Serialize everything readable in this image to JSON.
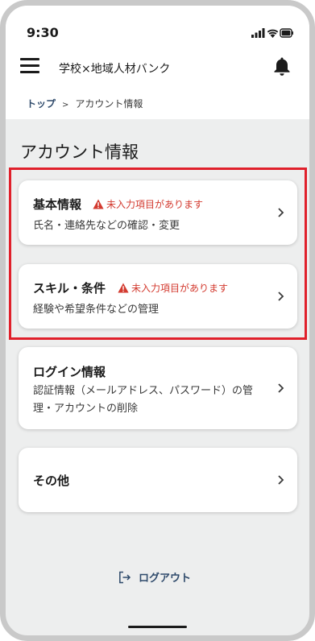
{
  "status_bar": {
    "time": "9:30"
  },
  "header": {
    "title": "学校×地域人材バンク"
  },
  "breadcrumb": {
    "home": "トップ",
    "current": "アカウント情報"
  },
  "page": {
    "title": "アカウント情報"
  },
  "cards": [
    {
      "title": "基本情報",
      "warning": "未入力項目があります",
      "desc": "氏名・連絡先などの確認・変更"
    },
    {
      "title": "スキル・条件",
      "warning": "未入力項目があります",
      "desc": "経験や希望条件などの管理"
    },
    {
      "title": "ログイン情報",
      "desc": "認証情報（メールアドレス、パスワード）の管理・アカウントの削除"
    },
    {
      "title": "その他"
    }
  ],
  "footer": {
    "logout_label": "ログアウト"
  },
  "colors": {
    "accent": "#2f4a6b",
    "warning": "#d33a2f",
    "highlight": "#e0202b",
    "background": "#edeeee"
  }
}
